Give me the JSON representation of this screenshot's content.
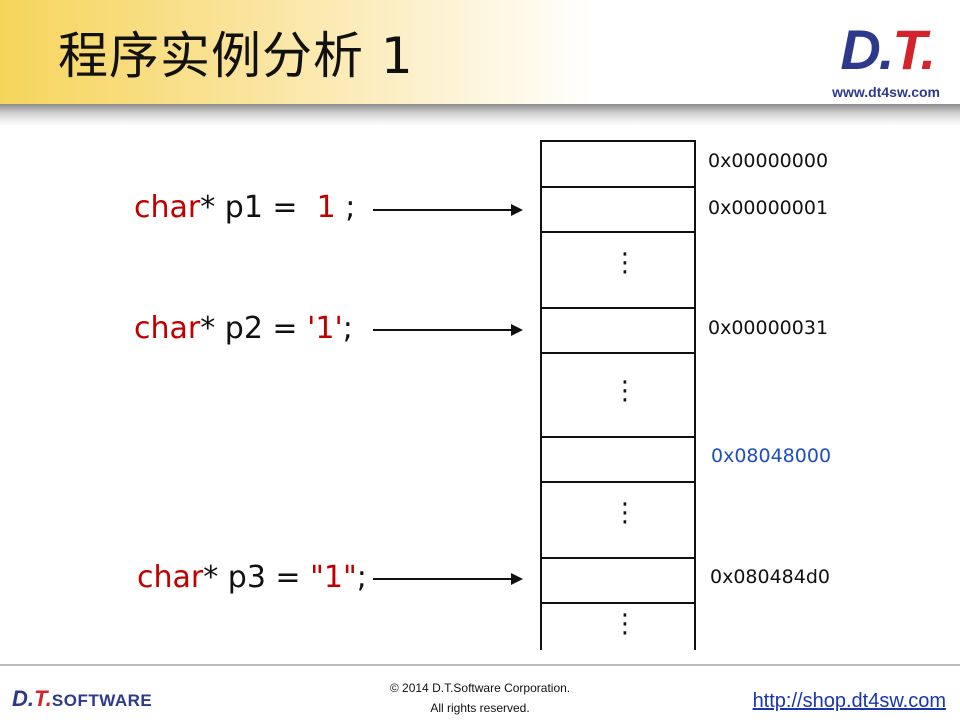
{
  "header": {
    "title": "程序实例分析 1",
    "logo_left": "D.",
    "logo_right": "T.",
    "logo_url": "www.dt4sw.com"
  },
  "code": [
    {
      "kw": "char",
      "rest1": "* p1 =  ",
      "lit": "1",
      "rest2": " ;"
    },
    {
      "kw": "char",
      "rest1": "* p2 = ",
      "lit": "'1'",
      "rest2": ";"
    },
    {
      "kw": "char",
      "rest1": "* p3 = ",
      "lit": "\"1\"",
      "rest2": ";"
    }
  ],
  "memory": {
    "dots": "⋮",
    "addresses": [
      "0x00000000",
      "0x00000001",
      "0x00000031",
      "0x08048000",
      "0x080484d0"
    ]
  },
  "colors": {
    "keyword": "#c00000",
    "highlight_address": "#1f4fbf",
    "brand_blue": "#2d3a8c",
    "brand_red": "#d4232a"
  },
  "footer": {
    "logo_main": "D.",
    "logo_t": "T.",
    "logo_text": "SOFTWARE",
    "copyright": "© 2014 D.T.Software Corporation.",
    "rights": "All rights reserved.",
    "site": "http://shop.dt4sw.com"
  }
}
